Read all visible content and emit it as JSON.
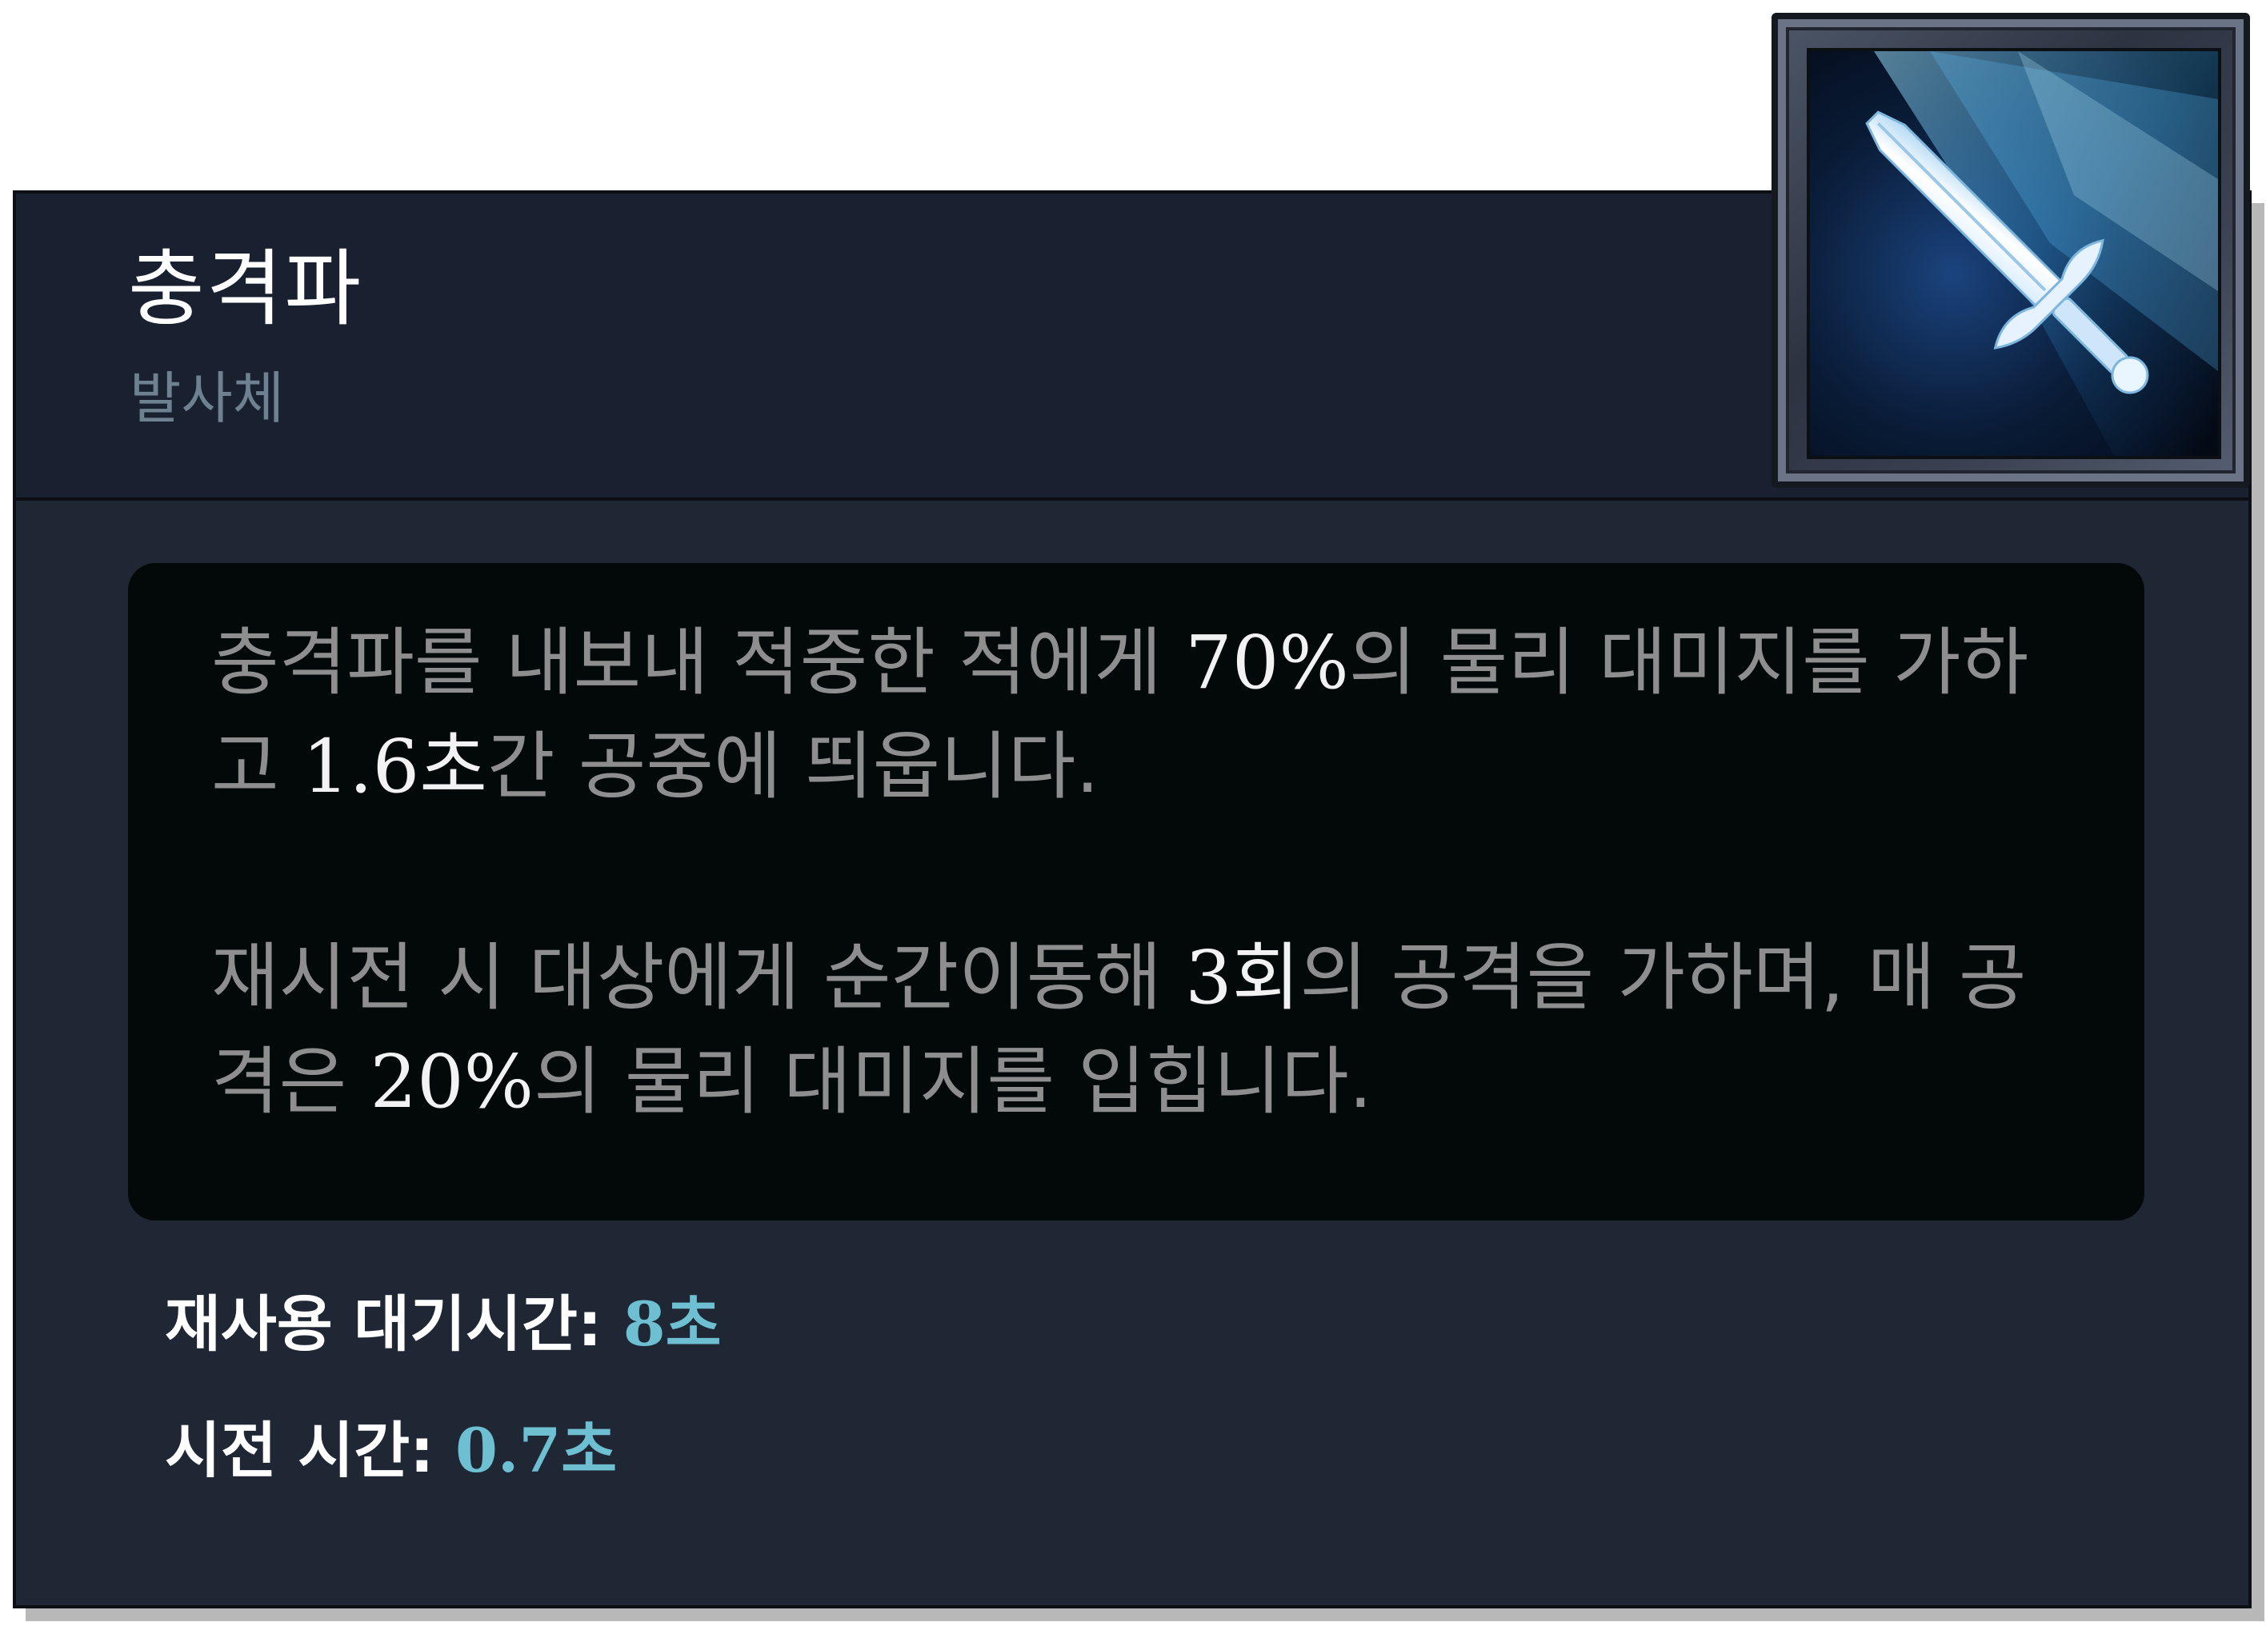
{
  "ability": {
    "name": "충격파",
    "type": "발사체",
    "icon": "sword-icon"
  },
  "description": {
    "p1": {
      "a": "충격파를 내보내 적중한 적에게 ",
      "v1": "70%",
      "b": "의 물리 대미지를 가하고 ",
      "v2_num": "1.6",
      "v2_unit": "초",
      "c": "간 공중에 띄웁니다."
    },
    "p2": {
      "a": "재시전 시 대상에게 순간이동해 ",
      "v1_num": "3",
      "v1_unit": "회",
      "b": "의 공격을 가하며, 매 공격은 ",
      "v2": "20%",
      "c": "의 물리 대미지를 입힙니다."
    }
  },
  "stats": {
    "cooldown_label": "재사용 대기시간:",
    "cooldown_num": "8",
    "cooldown_unit": "초",
    "cast_label": "시전 시간:",
    "cast_num": "0.7",
    "cast_unit": "초"
  },
  "colors": {
    "header_bg": "#192130",
    "body_bg": "#1f2735",
    "desc_bg": "#030909",
    "value_accent": "#6fbfd3",
    "subtitle": "#6e8190"
  }
}
